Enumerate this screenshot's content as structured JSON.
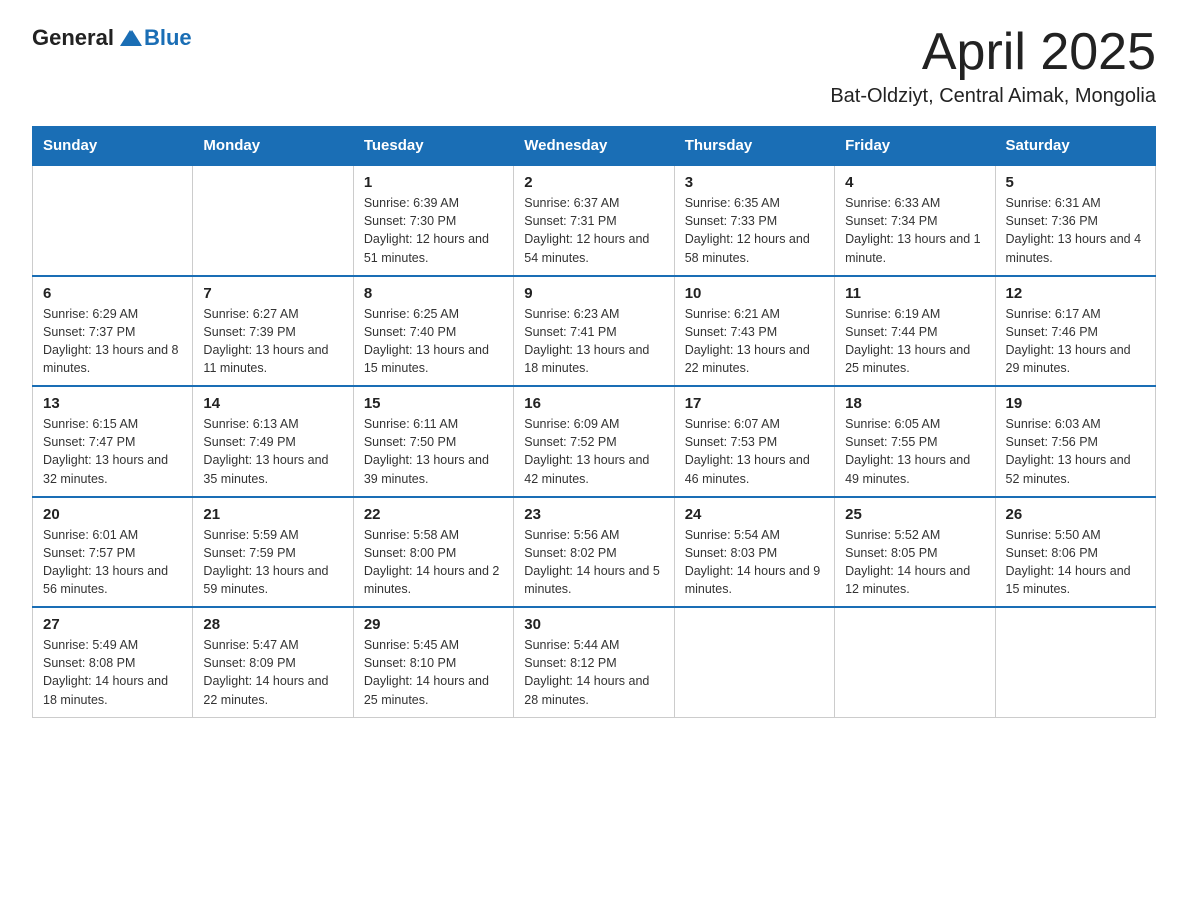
{
  "header": {
    "logo_general": "General",
    "logo_blue": "Blue",
    "title": "April 2025",
    "subtitle": "Bat-Oldziyt, Central Aimak, Mongolia"
  },
  "weekdays": [
    "Sunday",
    "Monday",
    "Tuesday",
    "Wednesday",
    "Thursday",
    "Friday",
    "Saturday"
  ],
  "weeks": [
    [
      {
        "day": "",
        "info": ""
      },
      {
        "day": "",
        "info": ""
      },
      {
        "day": "1",
        "info": "Sunrise: 6:39 AM\nSunset: 7:30 PM\nDaylight: 12 hours\nand 51 minutes."
      },
      {
        "day": "2",
        "info": "Sunrise: 6:37 AM\nSunset: 7:31 PM\nDaylight: 12 hours\nand 54 minutes."
      },
      {
        "day": "3",
        "info": "Sunrise: 6:35 AM\nSunset: 7:33 PM\nDaylight: 12 hours\nand 58 minutes."
      },
      {
        "day": "4",
        "info": "Sunrise: 6:33 AM\nSunset: 7:34 PM\nDaylight: 13 hours\nand 1 minute."
      },
      {
        "day": "5",
        "info": "Sunrise: 6:31 AM\nSunset: 7:36 PM\nDaylight: 13 hours\nand 4 minutes."
      }
    ],
    [
      {
        "day": "6",
        "info": "Sunrise: 6:29 AM\nSunset: 7:37 PM\nDaylight: 13 hours\nand 8 minutes."
      },
      {
        "day": "7",
        "info": "Sunrise: 6:27 AM\nSunset: 7:39 PM\nDaylight: 13 hours\nand 11 minutes."
      },
      {
        "day": "8",
        "info": "Sunrise: 6:25 AM\nSunset: 7:40 PM\nDaylight: 13 hours\nand 15 minutes."
      },
      {
        "day": "9",
        "info": "Sunrise: 6:23 AM\nSunset: 7:41 PM\nDaylight: 13 hours\nand 18 minutes."
      },
      {
        "day": "10",
        "info": "Sunrise: 6:21 AM\nSunset: 7:43 PM\nDaylight: 13 hours\nand 22 minutes."
      },
      {
        "day": "11",
        "info": "Sunrise: 6:19 AM\nSunset: 7:44 PM\nDaylight: 13 hours\nand 25 minutes."
      },
      {
        "day": "12",
        "info": "Sunrise: 6:17 AM\nSunset: 7:46 PM\nDaylight: 13 hours\nand 29 minutes."
      }
    ],
    [
      {
        "day": "13",
        "info": "Sunrise: 6:15 AM\nSunset: 7:47 PM\nDaylight: 13 hours\nand 32 minutes."
      },
      {
        "day": "14",
        "info": "Sunrise: 6:13 AM\nSunset: 7:49 PM\nDaylight: 13 hours\nand 35 minutes."
      },
      {
        "day": "15",
        "info": "Sunrise: 6:11 AM\nSunset: 7:50 PM\nDaylight: 13 hours\nand 39 minutes."
      },
      {
        "day": "16",
        "info": "Sunrise: 6:09 AM\nSunset: 7:52 PM\nDaylight: 13 hours\nand 42 minutes."
      },
      {
        "day": "17",
        "info": "Sunrise: 6:07 AM\nSunset: 7:53 PM\nDaylight: 13 hours\nand 46 minutes."
      },
      {
        "day": "18",
        "info": "Sunrise: 6:05 AM\nSunset: 7:55 PM\nDaylight: 13 hours\nand 49 minutes."
      },
      {
        "day": "19",
        "info": "Sunrise: 6:03 AM\nSunset: 7:56 PM\nDaylight: 13 hours\nand 52 minutes."
      }
    ],
    [
      {
        "day": "20",
        "info": "Sunrise: 6:01 AM\nSunset: 7:57 PM\nDaylight: 13 hours\nand 56 minutes."
      },
      {
        "day": "21",
        "info": "Sunrise: 5:59 AM\nSunset: 7:59 PM\nDaylight: 13 hours\nand 59 minutes."
      },
      {
        "day": "22",
        "info": "Sunrise: 5:58 AM\nSunset: 8:00 PM\nDaylight: 14 hours\nand 2 minutes."
      },
      {
        "day": "23",
        "info": "Sunrise: 5:56 AM\nSunset: 8:02 PM\nDaylight: 14 hours\nand 5 minutes."
      },
      {
        "day": "24",
        "info": "Sunrise: 5:54 AM\nSunset: 8:03 PM\nDaylight: 14 hours\nand 9 minutes."
      },
      {
        "day": "25",
        "info": "Sunrise: 5:52 AM\nSunset: 8:05 PM\nDaylight: 14 hours\nand 12 minutes."
      },
      {
        "day": "26",
        "info": "Sunrise: 5:50 AM\nSunset: 8:06 PM\nDaylight: 14 hours\nand 15 minutes."
      }
    ],
    [
      {
        "day": "27",
        "info": "Sunrise: 5:49 AM\nSunset: 8:08 PM\nDaylight: 14 hours\nand 18 minutes."
      },
      {
        "day": "28",
        "info": "Sunrise: 5:47 AM\nSunset: 8:09 PM\nDaylight: 14 hours\nand 22 minutes."
      },
      {
        "day": "29",
        "info": "Sunrise: 5:45 AM\nSunset: 8:10 PM\nDaylight: 14 hours\nand 25 minutes."
      },
      {
        "day": "30",
        "info": "Sunrise: 5:44 AM\nSunset: 8:12 PM\nDaylight: 14 hours\nand 28 minutes."
      },
      {
        "day": "",
        "info": ""
      },
      {
        "day": "",
        "info": ""
      },
      {
        "day": "",
        "info": ""
      }
    ]
  ]
}
